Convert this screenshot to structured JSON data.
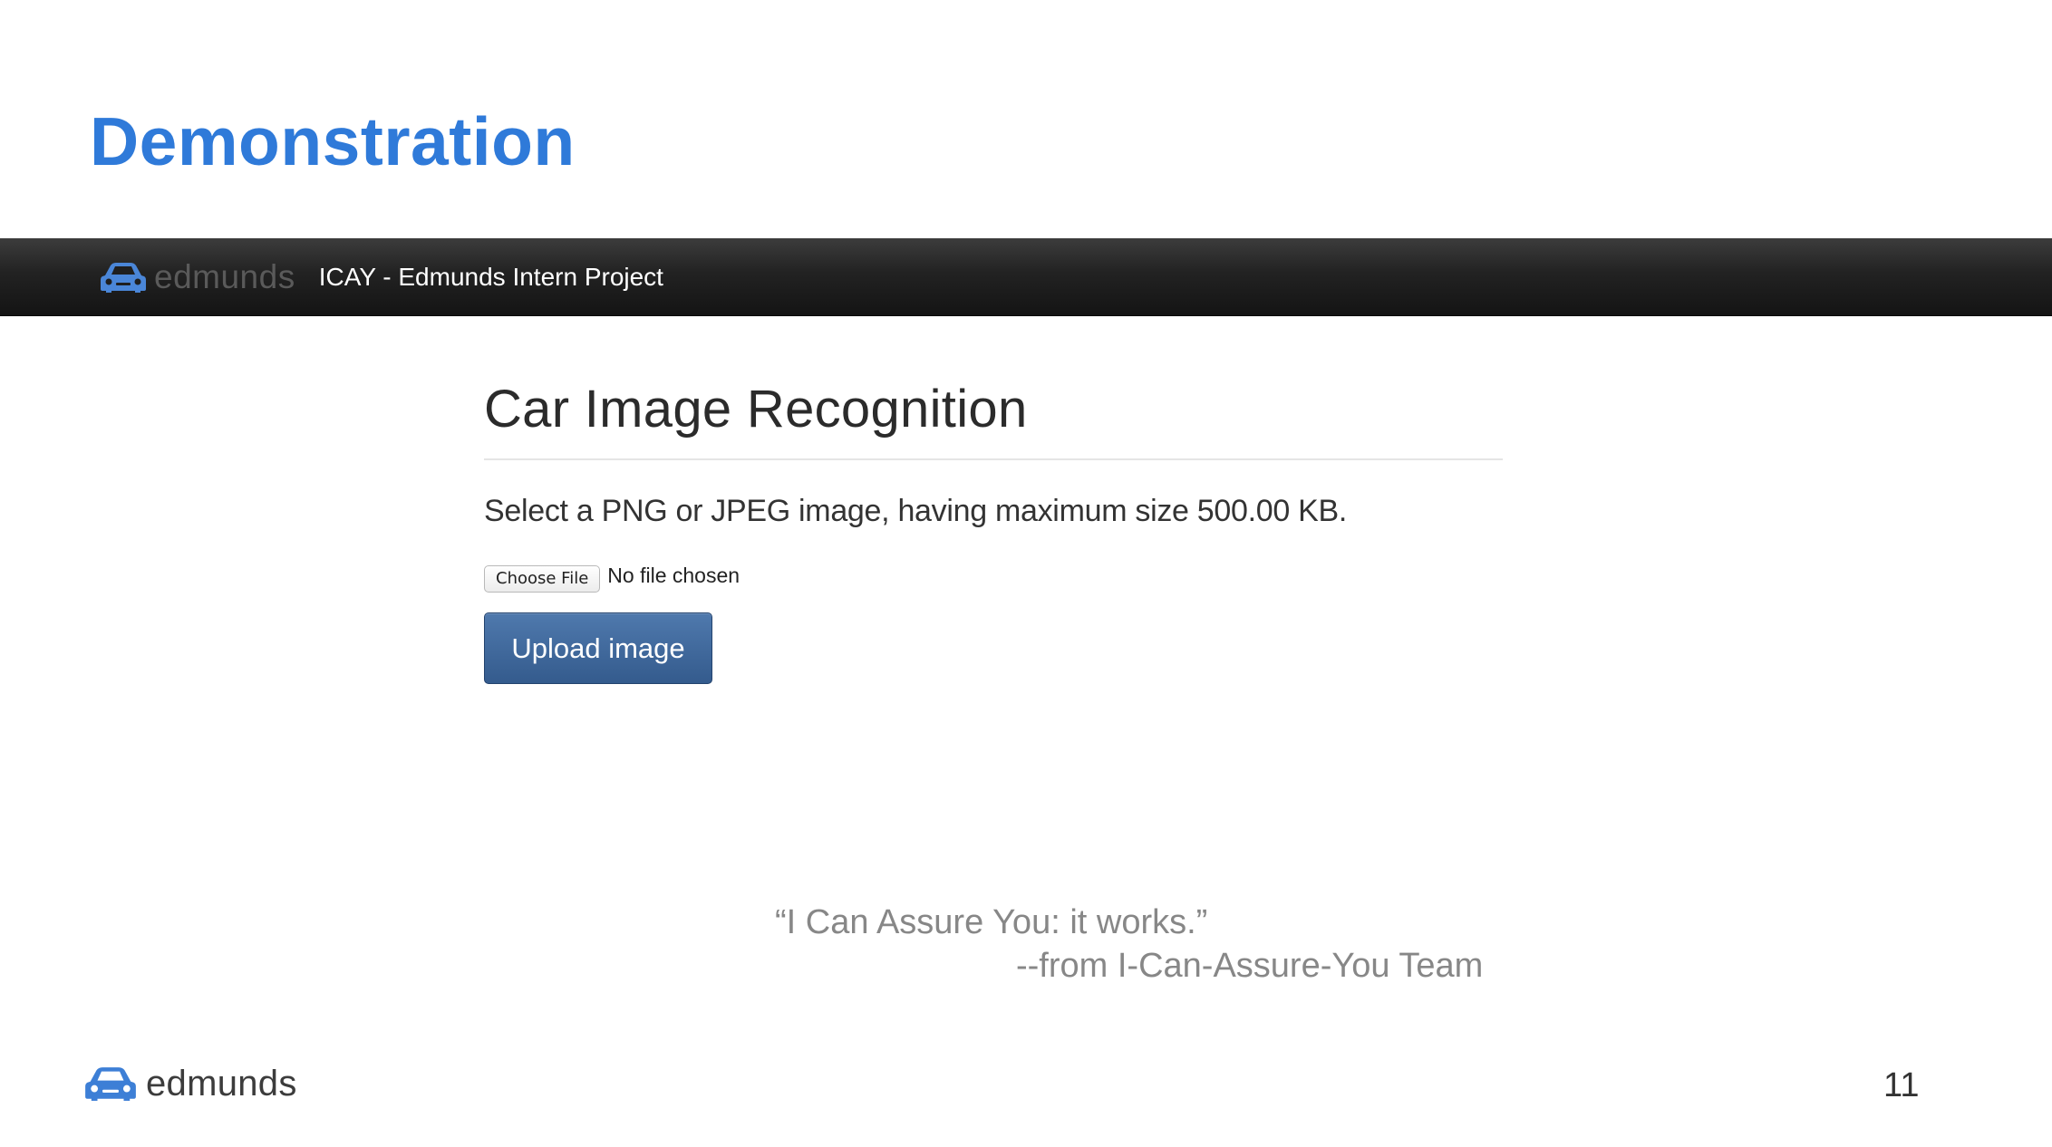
{
  "slide": {
    "title": "Demonstration",
    "page_number": "11"
  },
  "colors": {
    "accent": "#2f7ad9",
    "navbar": "#1f1f1f",
    "upload_button": "#3d659a",
    "quote_text": "#878787"
  },
  "browser": {
    "navbar": {
      "brand_icon": "car-icon",
      "brand_text": "edmunds",
      "project_title": "ICAY - Edmunds Intern Project"
    },
    "page": {
      "heading": "Car Image Recognition",
      "instructions": "Select a PNG or JPEG image, having maximum size 500.00 KB.",
      "file_input": {
        "button_label": "Choose File",
        "status": "No file chosen"
      },
      "upload_button": "Upload image"
    }
  },
  "quote": {
    "text": "“I Can Assure You: it works.”",
    "attribution": "--from I-Can-Assure-You Team"
  },
  "footer": {
    "brand_icon": "car-icon",
    "brand_text": "edmunds"
  }
}
